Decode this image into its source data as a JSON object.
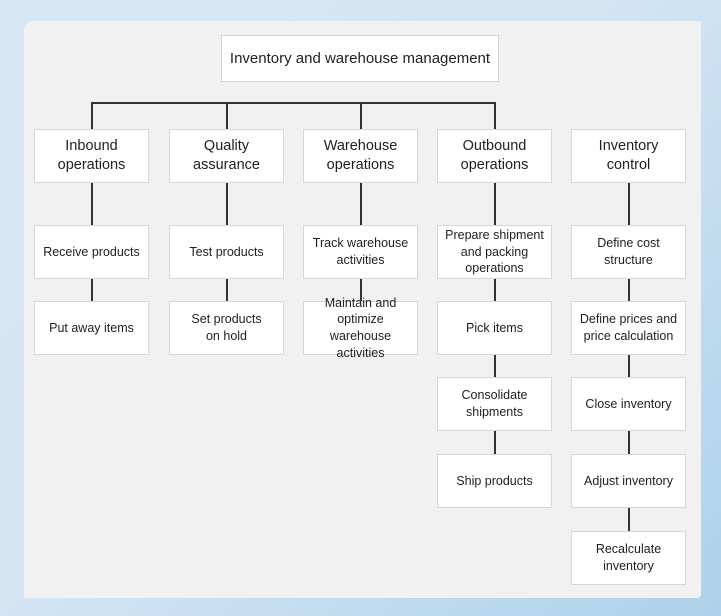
{
  "diagram": {
    "title": "Inventory and warehouse management",
    "type": "hierarchy-tree",
    "colors": {
      "page_background": "#d4e5f4",
      "panel_background": "#f1f1f1",
      "node_fill": "#ffffff",
      "node_border": "#d6d6d6",
      "connector": "#333333",
      "text": "#1f1f1f"
    },
    "root": {
      "label": "Inventory and warehouse management"
    },
    "columns": [
      {
        "id": "inbound",
        "header": "Inbound\noperations",
        "connected_to_root": true,
        "steps": [
          "Receive products",
          "Put away items"
        ]
      },
      {
        "id": "quality",
        "header": "Quality\nassurance",
        "connected_to_root": true,
        "steps": [
          "Test products",
          "Set products\non hold"
        ]
      },
      {
        "id": "warehouse",
        "header": "Warehouse\noperations",
        "connected_to_root": true,
        "steps": [
          "Track warehouse\nactivities",
          "Maintain and\noptimize warehouse\nactivities"
        ]
      },
      {
        "id": "outbound",
        "header": "Outbound\noperations",
        "connected_to_root": true,
        "steps": [
          "Prepare shipment\nand packing\noperations",
          "Pick items",
          "Consolidate\nshipments",
          "Ship products"
        ]
      },
      {
        "id": "inventory-control",
        "header": "Inventory control",
        "connected_to_root": false,
        "steps": [
          "Define cost structure",
          "Define prices and\nprice calculation",
          "Close inventory",
          "Adjust inventory",
          "Recalculate\ninventory"
        ]
      }
    ]
  }
}
